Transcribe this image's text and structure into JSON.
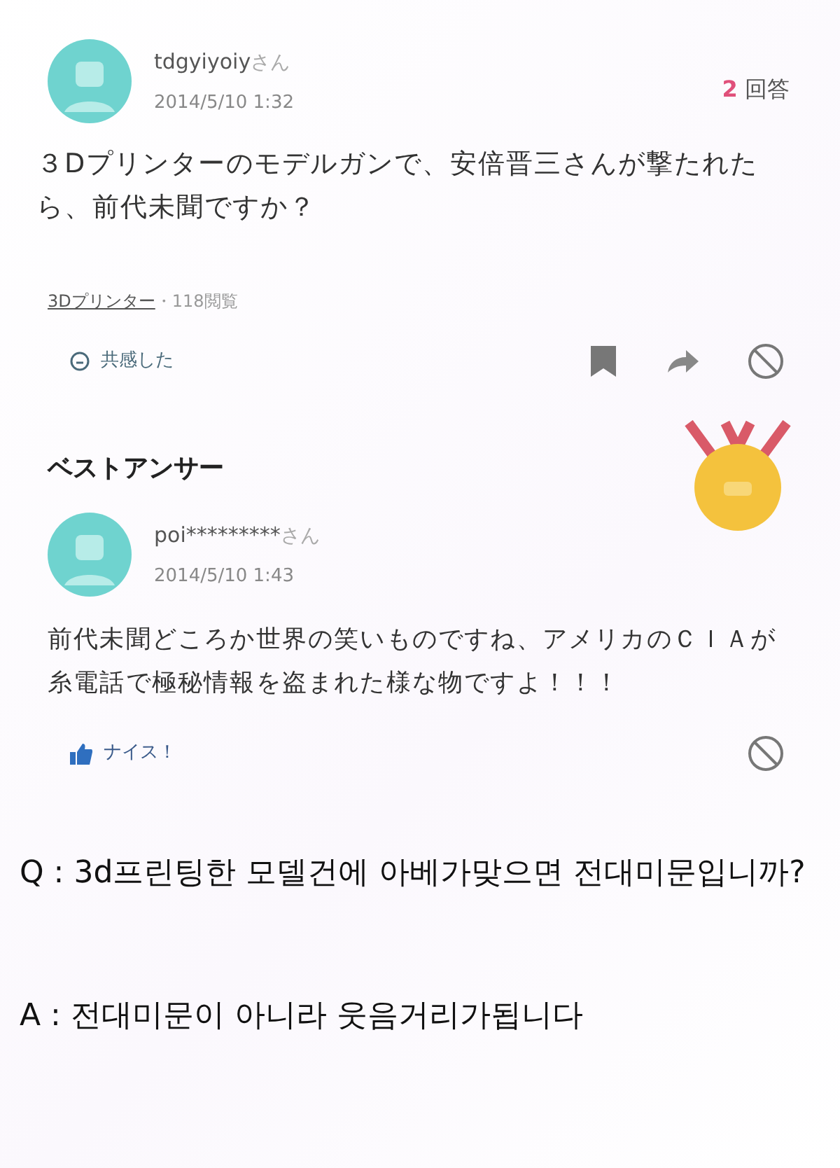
{
  "question": {
    "user": "tdgyiyoiy",
    "honorific": "さん",
    "date": "2014/5/10 1:32",
    "answer_count": "2",
    "answer_unit": "回答",
    "text": "３Dプリンターのモデルガンで、安倍晋三さんが撃たれたら、前代未聞ですか？",
    "tag": "3Dプリンター",
    "views": "・118閲覧",
    "empathy": "共感した"
  },
  "best_answer": {
    "heading": "ベストアンサー",
    "user": "poi*********",
    "honorific": "さん",
    "date": "2014/5/10 1:43",
    "text": "前代未聞どころか世界の笑いものですね、アメリカのＣＩＡが糸電話で極秘情報を盗まれた様な物ですよ！！！",
    "nice": "ナイス！"
  },
  "caption": [
    {
      "text": "Q : 3d프린팅한 모델건에 아베가맞으면 전대미문입니까?"
    },
    {
      "text": "A : 전대미문이 아니라 웃음거리가됩니다"
    }
  ]
}
